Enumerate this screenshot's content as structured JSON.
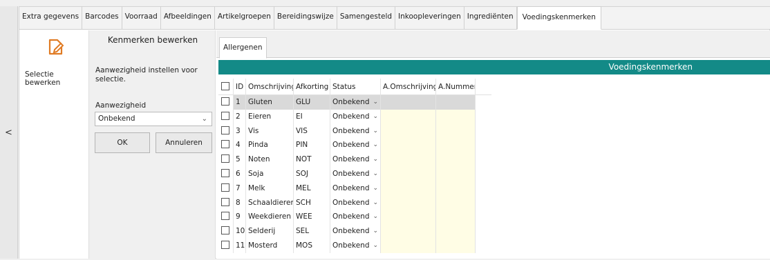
{
  "tabs": [
    "Extra gegevens",
    "Barcodes",
    "Voorraad",
    "Afbeeldingen",
    "Artikelgroepen",
    "Bereidingswijze",
    "Samengesteld",
    "Inkoopleveringen",
    "Ingrediënten",
    "Voedingskenmerken"
  ],
  "active_tab": "Voedingskenmerken",
  "collapse_glyph": "<",
  "left": {
    "action_label": "Selectie bewerken",
    "icon": "edit-document-icon"
  },
  "panel": {
    "title": "Kenmerken bewerken",
    "description": "Aanwezigheid instellen voor selectie.",
    "field_label": "Aanwezigheid",
    "field_value": "Onbekend",
    "ok_label": "OK",
    "cancel_label": "Annuleren"
  },
  "subtab": "Allergenen",
  "grid": {
    "title": "Voedingskenmerken",
    "headers": {
      "id": "ID",
      "omschrijving": "Omschrijving",
      "afkorting": "Afkorting",
      "status": "Status",
      "a_omschrijving": "A.Omschrijving",
      "a_nummer": "A.Nummer"
    },
    "rows": [
      {
        "id": "1",
        "omschrijving": "Gluten",
        "afkorting": "GLU",
        "status": "Onbekend"
      },
      {
        "id": "2",
        "omschrijving": "Eieren",
        "afkorting": "EI",
        "status": "Onbekend"
      },
      {
        "id": "3",
        "omschrijving": "Vis",
        "afkorting": "VIS",
        "status": "Onbekend"
      },
      {
        "id": "4",
        "omschrijving": "Pinda",
        "afkorting": "PIN",
        "status": "Onbekend"
      },
      {
        "id": "5",
        "omschrijving": "Noten",
        "afkorting": "NOT",
        "status": "Onbekend"
      },
      {
        "id": "6",
        "omschrijving": "Soja",
        "afkorting": "SOJ",
        "status": "Onbekend"
      },
      {
        "id": "7",
        "omschrijving": "Melk",
        "afkorting": "MEL",
        "status": "Onbekend"
      },
      {
        "id": "8",
        "omschrijving": "Schaaldieren",
        "afkorting": "SCH",
        "status": "Onbekend"
      },
      {
        "id": "9",
        "omschrijving": "Weekdieren",
        "afkorting": "WEE",
        "status": "Onbekend"
      },
      {
        "id": "10",
        "omschrijving": "Selderij",
        "afkorting": "SEL",
        "status": "Onbekend"
      },
      {
        "id": "11",
        "omschrijving": "Mosterd",
        "afkorting": "MOS",
        "status": "Onbekend"
      }
    ]
  },
  "colors": {
    "grid_header": "#138a87",
    "highlight": "#fffde5",
    "selected_row": "#d9d9d9"
  }
}
